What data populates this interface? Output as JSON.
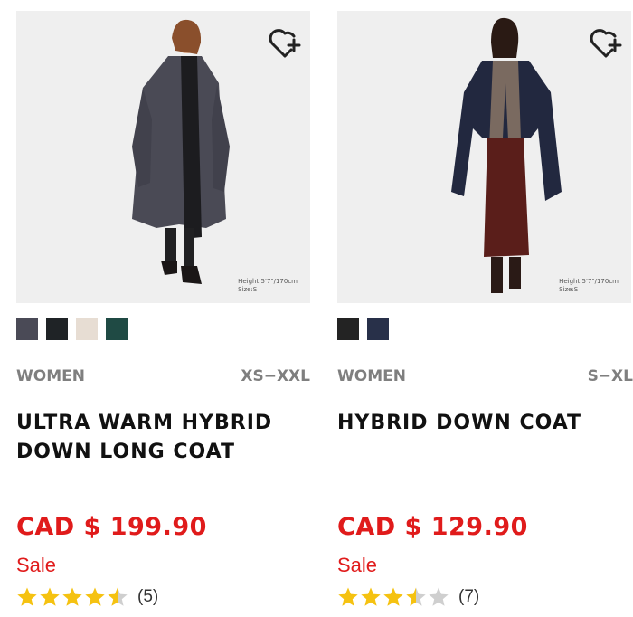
{
  "colors": {
    "price_red": "#e01b1b",
    "star_gold": "#f5c211",
    "star_gray": "#cfcfcf",
    "meta_gray": "#7f7f7f"
  },
  "products": [
    {
      "category": "WOMEN",
      "sizes": "XS−XXL",
      "name_line1": "ULTRA WARM HYBRID",
      "name_line2": "DOWN LONG COAT",
      "price": "CAD $ 199.90",
      "sale_label": "Sale",
      "rating": 4.5,
      "review_count": "(5)",
      "model_height": "Height:5'7\"/170cm",
      "model_size": "Size:S",
      "swatches": [
        "#4a4a56",
        "#1f2326",
        "#e7ddd3",
        "#1f4a44"
      ],
      "icon": "heart-plus-icon"
    },
    {
      "category": "WOMEN",
      "sizes": "S−XL",
      "name_line1": "HYBRID DOWN COAT",
      "name_line2": "",
      "price": "CAD $ 129.90",
      "sale_label": "Sale",
      "rating": 3.5,
      "review_count": "(7)",
      "model_height": "Height:5'7\"/170cm",
      "model_size": "Size:S",
      "swatches": [
        "#232323",
        "#283049"
      ],
      "icon": "heart-plus-icon"
    }
  ]
}
